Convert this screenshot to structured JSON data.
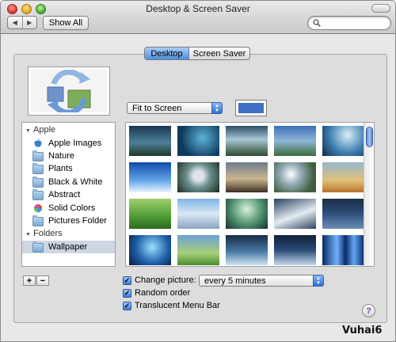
{
  "window": {
    "title": "Desktop & Screen Saver"
  },
  "toolbar": {
    "back": "◀",
    "forward": "▶",
    "show_all": "Show All",
    "search_value": ""
  },
  "tabs": [
    {
      "label": "Desktop",
      "selected": true
    },
    {
      "label": "Screen Saver",
      "selected": false
    }
  ],
  "fit_select": {
    "value": "Fit to Screen"
  },
  "desktop_color": "#3f70c6",
  "sources": {
    "apple_group": "Apple",
    "apple_items": [
      "Apple Images",
      "Nature",
      "Plants",
      "Black & White",
      "Abstract",
      "Solid Colors",
      "Pictures Folder"
    ],
    "folders_group": "Folders",
    "folder_items": [
      "Wallpaper"
    ],
    "add": "+",
    "remove": "−"
  },
  "options": {
    "change_picture": {
      "label": "Change picture:",
      "checked": true
    },
    "interval": "every 5 minutes",
    "random_order": {
      "label": "Random order",
      "checked": true
    },
    "translucent_menu_bar": {
      "label": "Translucent Menu Bar",
      "checked": true
    }
  },
  "help": "?",
  "watermark": "Vuhai6"
}
